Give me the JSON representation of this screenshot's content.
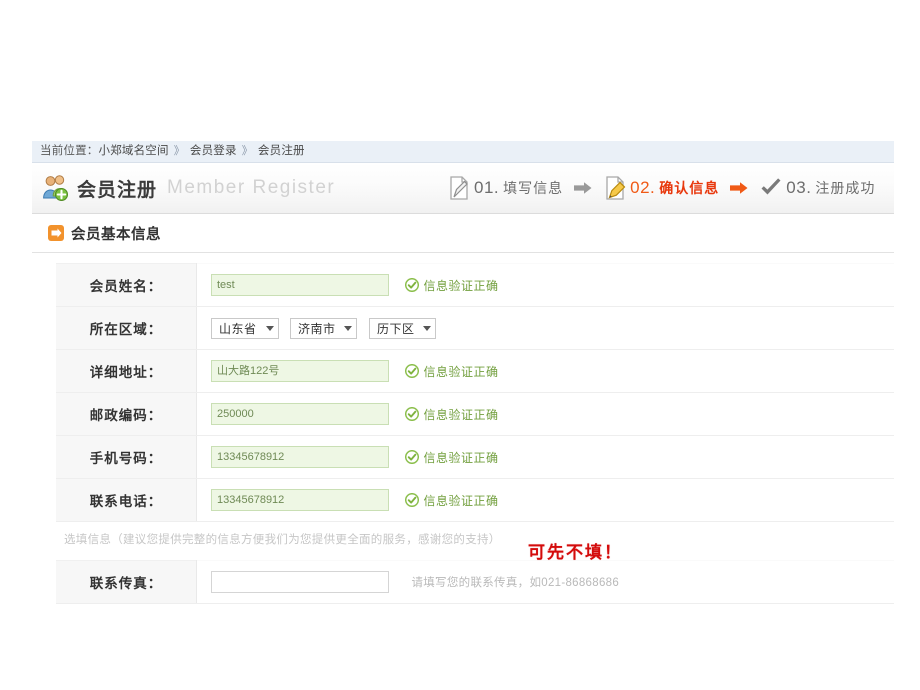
{
  "breadcrumb": {
    "prefix": "当前位置：",
    "items": [
      "小郑域名空间",
      "会员登录",
      "会员注册"
    ],
    "separator": "》"
  },
  "header": {
    "icon": "users-add-icon",
    "title_cn": "会员注册",
    "title_en": "Member Register",
    "steps": [
      {
        "icon": "document-icon",
        "num": "01.",
        "label": "填写信息",
        "state": "done"
      },
      {
        "icon": "document-edit-icon",
        "num": "02.",
        "label": "确认信息",
        "state": "active"
      },
      {
        "icon": "checkmark-icon",
        "num": "03.",
        "label": "注册成功",
        "state": "pending"
      }
    ],
    "arrow_icon": "arrow-right-icon"
  },
  "section": {
    "icon": "orange-arrow-icon",
    "title": "会员基本信息"
  },
  "form": {
    "rows": [
      {
        "label": "会员姓名：",
        "type": "text",
        "value": "test",
        "status": "信息验证正确",
        "status_icon": "check-circle-icon"
      },
      {
        "label": "所在区域：",
        "type": "selects",
        "selects": [
          {
            "name": "province-select",
            "value": "山东省"
          },
          {
            "name": "city-select",
            "value": "济南市"
          },
          {
            "name": "district-select",
            "value": "历下区"
          }
        ]
      },
      {
        "label": "详细地址：",
        "type": "text",
        "value": "山大路122号",
        "status": "信息验证正确",
        "status_icon": "check-circle-icon"
      },
      {
        "label": "邮政编码：",
        "type": "text",
        "value": "250000",
        "status": "信息验证正确",
        "status_icon": "check-circle-icon"
      },
      {
        "label": "手机号码：",
        "type": "text",
        "value": "13345678912",
        "status": "信息验证正确",
        "status_icon": "check-circle-icon"
      },
      {
        "label": "联系电话：",
        "type": "text",
        "value": "13345678912",
        "status": "信息验证正确",
        "status_icon": "check-circle-icon"
      }
    ],
    "optional_notice": "选填信息（建议您提供完整的信息方便我们为您提供更全面的服务，感谢您的支持）",
    "annotation": "可先不填！",
    "optional_rows": [
      {
        "label": "联系传真：",
        "type": "text",
        "value": "",
        "placeholder": "",
        "hint": "请填写您的联系传真，如021-86868686"
      }
    ]
  },
  "colors": {
    "active_step": "#e8380d",
    "valid_green": "#73a03f",
    "annotation_red": "#d40b0b",
    "section_orange": "#f08819",
    "input_bg": "#eef7e4",
    "breadcrumb_bg": "#eaf0f7"
  }
}
